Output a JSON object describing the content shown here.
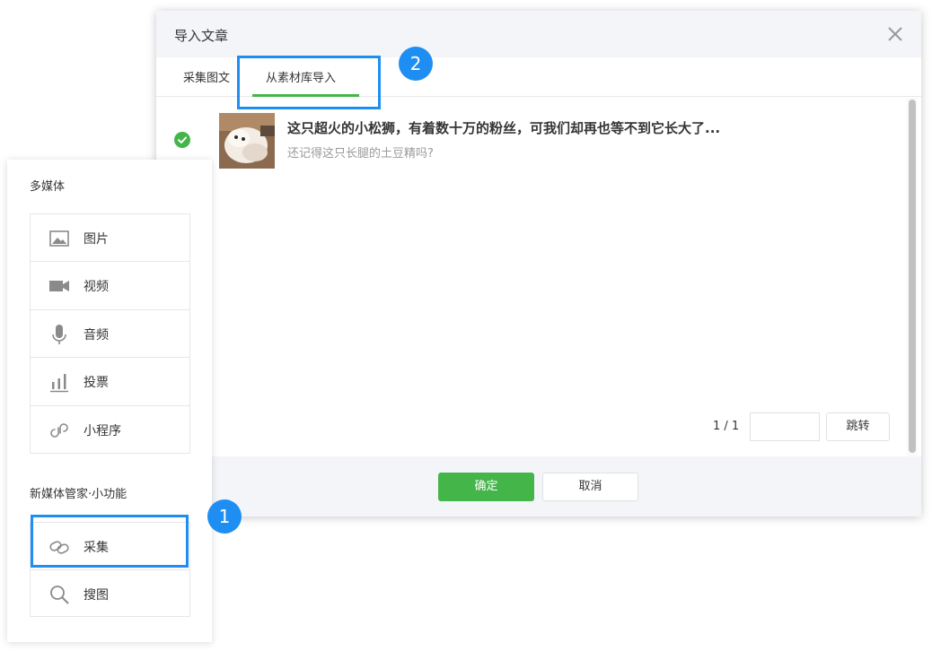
{
  "dialog": {
    "title": "导入文章",
    "tabs": [
      {
        "label": "采集图文"
      },
      {
        "label": "从素材库导入"
      }
    ],
    "article": {
      "title": "这只超火的小松狮，有着数十万的粉丝，可我们却再也等不到它长大了...",
      "description": "还记得这只长腿的土豆精吗?"
    },
    "pager": {
      "count": "1 / 1",
      "jump_label": "跳转",
      "input_value": ""
    },
    "confirm_label": "确定",
    "cancel_label": "取消"
  },
  "panel": {
    "section1_title": "多媒体",
    "media_items": [
      {
        "label": "图片",
        "icon": "image-icon"
      },
      {
        "label": "视频",
        "icon": "video-icon"
      },
      {
        "label": "音频",
        "icon": "microphone-icon"
      },
      {
        "label": "投票",
        "icon": "vote-chart-icon"
      },
      {
        "label": "小程序",
        "icon": "mini-program-icon"
      }
    ],
    "section2_title": "新媒体管家·小功能",
    "tool_items": [
      {
        "label": "采集",
        "icon": "link-icon"
      },
      {
        "label": "搜图",
        "icon": "search-icon"
      }
    ]
  },
  "annotations": {
    "step1": "1",
    "step2": "2"
  },
  "colors": {
    "accent_green": "#44b549",
    "highlight_blue": "#1e8ef3",
    "header_bg": "#f4f5f9"
  }
}
